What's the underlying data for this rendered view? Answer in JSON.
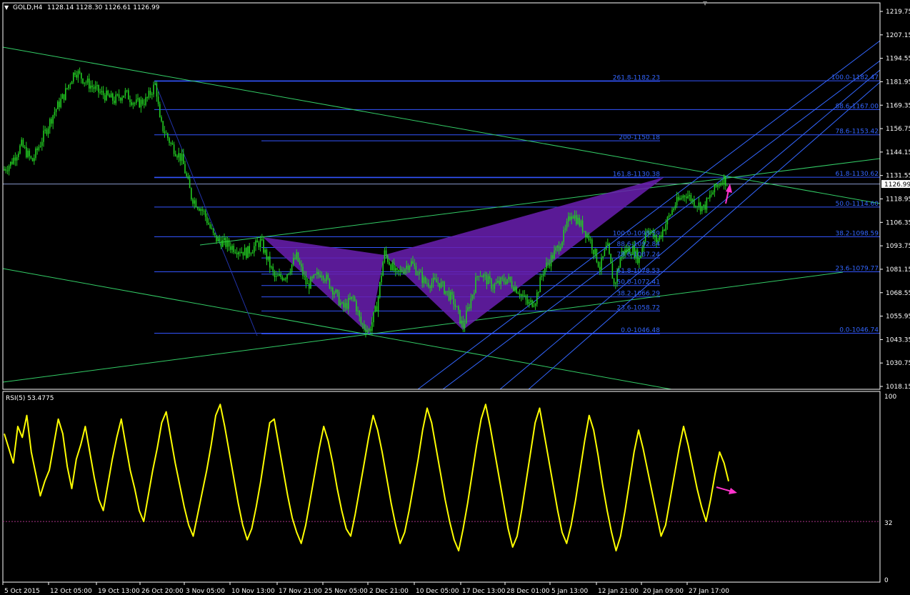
{
  "header": {
    "title": "GOLD,H4",
    "ohlc": "1128.14 1128.30 1126.61 1126.99",
    "current_price": "1126.99"
  },
  "rsi_panel": {
    "label": "RSI(5) 53.4775",
    "levels": [
      "100",
      "32",
      "0"
    ]
  },
  "colors": {
    "background": "#000000",
    "candle": "#22cc22",
    "grid_border": "#ffffff",
    "fib_line": "#3355ff",
    "fib_text": "#3366ff",
    "trendline": "#33cc66",
    "channel": "#3366ff",
    "pattern_fill": "#6a1fb0",
    "rsi_line": "#ffff00",
    "arrow": "#ff33cc",
    "rsi_level": "#aa3388"
  },
  "chart_data": [
    {
      "type": "candlestick",
      "title": "GOLD,H4",
      "ylim": [
        1018.15,
        1219.75
      ],
      "y_ticks": [
        "1219.75",
        "1207.15",
        "1194.55",
        "1181.95",
        "1169.35",
        "1156.75",
        "1144.15",
        "1131.55",
        "1118.95",
        "1106.35",
        "1093.75",
        "1081.15",
        "1068.55",
        "1055.95",
        "1043.35",
        "1030.75",
        "1018.15"
      ],
      "x_ticks": [
        "5 Oct 2015",
        "12 Oct 05:00",
        "19 Oct 13:00",
        "26 Oct 20:00",
        "3 Nov 05:00",
        "10 Nov 13:00",
        "17 Nov 21:00",
        "25 Nov 05:00",
        "2 Dec 21:00",
        "10 Dec 05:00",
        "17 Dec 13:00",
        "28 Dec 01:00",
        "5 Jan 13:00",
        "12 Jan 21:00",
        "20 Jan 09:00",
        "27 Jan 17:00"
      ],
      "price_path": [
        [
          0,
          1133
        ],
        [
          15,
          1138
        ],
        [
          30,
          1148
        ],
        [
          45,
          1139
        ],
        [
          60,
          1152
        ],
        [
          75,
          1165
        ],
        [
          90,
          1175
        ],
        [
          105,
          1188
        ],
        [
          120,
          1182
        ],
        [
          140,
          1176
        ],
        [
          160,
          1172
        ],
        [
          175,
          1176
        ],
        [
          190,
          1170
        ],
        [
          205,
          1172
        ],
        [
          218,
          1181
        ],
        [
          224,
          1160
        ],
        [
          240,
          1148
        ],
        [
          255,
          1140
        ],
        [
          268,
          1120
        ],
        [
          285,
          1112
        ],
        [
          300,
          1098
        ],
        [
          320,
          1094
        ],
        [
          345,
          1090
        ],
        [
          365,
          1096
        ],
        [
          385,
          1076
        ],
        [
          400,
          1078
        ],
        [
          415,
          1088
        ],
        [
          430,
          1072
        ],
        [
          450,
          1080
        ],
        [
          470,
          1068
        ],
        [
          480,
          1060
        ],
        [
          495,
          1066
        ],
        [
          505,
          1052
        ],
        [
          517,
          1048
        ],
        [
          528,
          1062
        ],
        [
          538,
          1090
        ],
        [
          555,
          1078
        ],
        [
          575,
          1085
        ],
        [
          595,
          1074
        ],
        [
          615,
          1074
        ],
        [
          635,
          1064
        ],
        [
          648,
          1050
        ],
        [
          660,
          1066
        ],
        [
          670,
          1080
        ],
        [
          690,
          1072
        ],
        [
          710,
          1076
        ],
        [
          725,
          1070
        ],
        [
          740,
          1062
        ],
        [
          750,
          1065
        ],
        [
          760,
          1080
        ],
        [
          780,
          1092
        ],
        [
          790,
          1100
        ],
        [
          800,
          1112
        ],
        [
          815,
          1104
        ],
        [
          825,
          1098
        ],
        [
          840,
          1082
        ],
        [
          850,
          1094
        ],
        [
          860,
          1072
        ],
        [
          870,
          1090
        ],
        [
          885,
          1092
        ],
        [
          895,
          1086
        ],
        [
          905,
          1104
        ],
        [
          920,
          1096
        ],
        [
          930,
          1104
        ],
        [
          945,
          1116
        ],
        [
          960,
          1122
        ],
        [
          970,
          1118
        ],
        [
          985,
          1114
        ],
        [
          1000,
          1124
        ],
        [
          1012,
          1130
        ],
        [
          1020,
          1127
        ]
      ],
      "annotations": {
        "fib_left": [
          {
            "label": "261.8-1182.23",
            "price": 1182.23
          },
          {
            "label": "200-1150.18",
            "price": 1150.18
          },
          {
            "label": "161.8-1130.38",
            "price": 1130.38
          },
          {
            "label": "100.0-1098.59",
            "price": 1098.59
          },
          {
            "label": "88.6-1092.84",
            "price": 1092.84
          },
          {
            "label": "78.6-1087.24",
            "price": 1087.24
          },
          {
            "label": "61.8-1078.53",
            "price": 1078.53
          },
          {
            "label": "50.0-1072.41",
            "price": 1072.41
          },
          {
            "label": "38.2-1066.29",
            "price": 1066.29
          },
          {
            "label": "23.6-1058.72",
            "price": 1058.72
          },
          {
            "label": "0.0-1046.48",
            "price": 1046.48
          }
        ],
        "fib_right": [
          {
            "label": "100.0-1182.47",
            "price": 1182.47
          },
          {
            "label": "88.6-1167.00",
            "price": 1167.0
          },
          {
            "label": "78.6-1153.42",
            "price": 1153.42
          },
          {
            "label": "61.8-1130.62",
            "price": 1130.62
          },
          {
            "label": "50.0-1114.60",
            "price": 1114.6
          },
          {
            "label": "38.2-1098.59",
            "price": 1098.59
          },
          {
            "label": "23.6-1079.77",
            "price": 1079.77
          },
          {
            "label": "0.0-1046.74",
            "price": 1046.74
          }
        ]
      }
    },
    {
      "type": "line",
      "title": "RSI(5) 53.4775",
      "ylim": [
        0,
        100
      ],
      "levels": [
        32
      ],
      "values": [
        80,
        72,
        64,
        84,
        78,
        90,
        70,
        58,
        46,
        54,
        60,
        74,
        88,
        80,
        62,
        50,
        66,
        74,
        84,
        70,
        56,
        44,
        38,
        52,
        66,
        78,
        88,
        74,
        60,
        50,
        38,
        32,
        46,
        60,
        72,
        86,
        92,
        78,
        64,
        52,
        40,
        30,
        24,
        36,
        48,
        60,
        74,
        90,
        96,
        84,
        70,
        56,
        42,
        30,
        22,
        28,
        40,
        54,
        70,
        86,
        88,
        74,
        60,
        46,
        34,
        26,
        20,
        30,
        44,
        58,
        72,
        84,
        76,
        64,
        50,
        38,
        28,
        24,
        36,
        50,
        64,
        78,
        90,
        82,
        70,
        56,
        42,
        30,
        20,
        26,
        38,
        52,
        66,
        82,
        94,
        86,
        72,
        58,
        44,
        32,
        22,
        16,
        28,
        42,
        58,
        74,
        88,
        96,
        84,
        70,
        56,
        42,
        28,
        18,
        24,
        38,
        54,
        70,
        86,
        94,
        80,
        66,
        52,
        38,
        26,
        20,
        30,
        44,
        60,
        76,
        90,
        82,
        68,
        52,
        38,
        26,
        16,
        24,
        38,
        54,
        70,
        82,
        72,
        60,
        48,
        36,
        24,
        30,
        44,
        58,
        72,
        84,
        74,
        62,
        50,
        40,
        32,
        44,
        58,
        70,
        64,
        54
      ]
    }
  ]
}
